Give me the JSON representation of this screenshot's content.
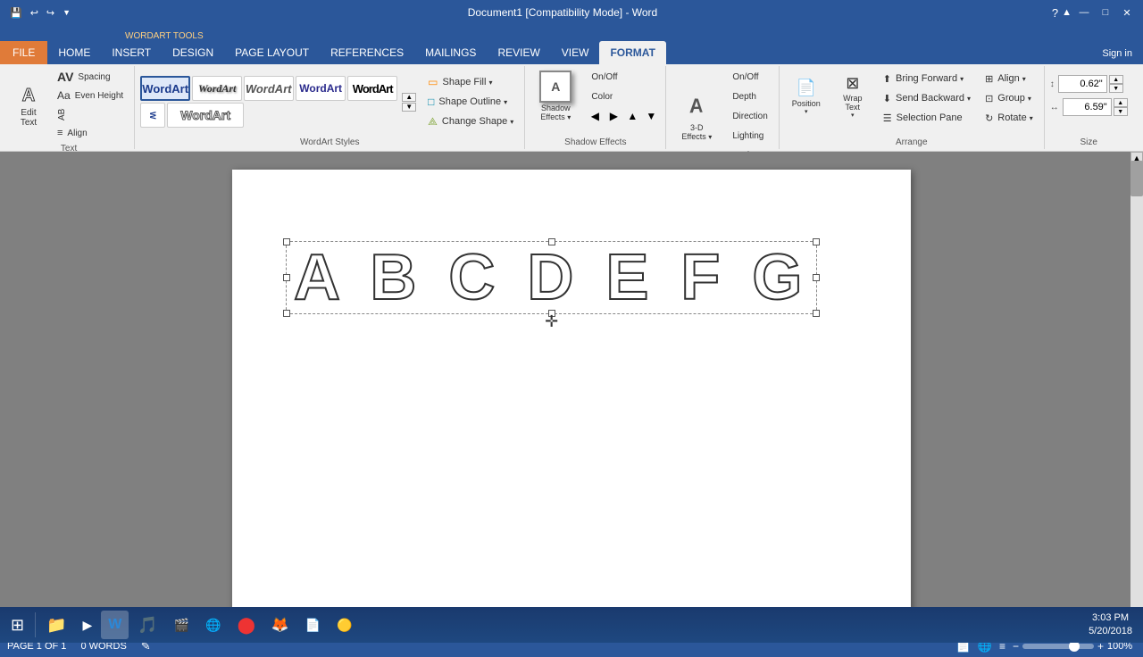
{
  "titlebar": {
    "title": "Document1 [Compatibility Mode] - Word",
    "wordart_tools_label": "WORDART TOOLS",
    "win_buttons": [
      "—",
      "□",
      "✕"
    ],
    "quick_access": [
      "💾",
      "↩",
      "↪"
    ]
  },
  "ribbon_tabs": {
    "file": "FILE",
    "tabs": [
      "HOME",
      "INSERT",
      "DESIGN",
      "PAGE LAYOUT",
      "REFERENCES",
      "MAILINGS",
      "REVIEW",
      "VIEW"
    ],
    "context_label": "WORDART TOOLS",
    "active_tab": "FORMAT"
  },
  "groups": {
    "text": {
      "label": "Text",
      "edit_label": "Edit\nText",
      "spacing_label": "Spacing",
      "even_height_label": "Aa"
    },
    "wordart_styles": {
      "label": "WordArt Styles",
      "shape_fill": "Shape Fill",
      "shape_outline": "Shape Outline",
      "change_shape": "Change Shape",
      "thumbnails": [
        "WordArt",
        "WordArt",
        "WordArt",
        "WordArt",
        "WordArt"
      ]
    },
    "shadow_effects": {
      "label": "Shadow Effects",
      "title": "Shadow Effects ▾"
    },
    "threed_effects": {
      "label": "3-D Effects",
      "title": "3-D\nEffects ▾"
    },
    "arrange": {
      "label": "Arrange",
      "bring_forward": "Bring Forward",
      "send_backward": "Send Backward",
      "selection_pane": "Selection Pane",
      "position": "Position",
      "wrap_text": "Wrap\nText"
    },
    "size": {
      "label": "Size",
      "height_label": "Height",
      "width_label": "Width",
      "height_value": "0.62\"",
      "width_value": "6.59\""
    }
  },
  "document": {
    "wordart_text": "A B C D E F G",
    "page_label": "PAGE 1 OF 1",
    "words_label": "0 WORDS"
  },
  "statusbar": {
    "page": "PAGE 1 OF 1",
    "words": "0 WORDS",
    "zoom": "100%"
  },
  "taskbar": {
    "time": "3:03 PM",
    "date": "5/20/2018",
    "apps": [
      "⊞",
      "📁",
      "▶",
      "W",
      "🎵",
      "🎬",
      "🌐",
      "🔴",
      "🦊",
      "📄",
      "🟡"
    ]
  }
}
